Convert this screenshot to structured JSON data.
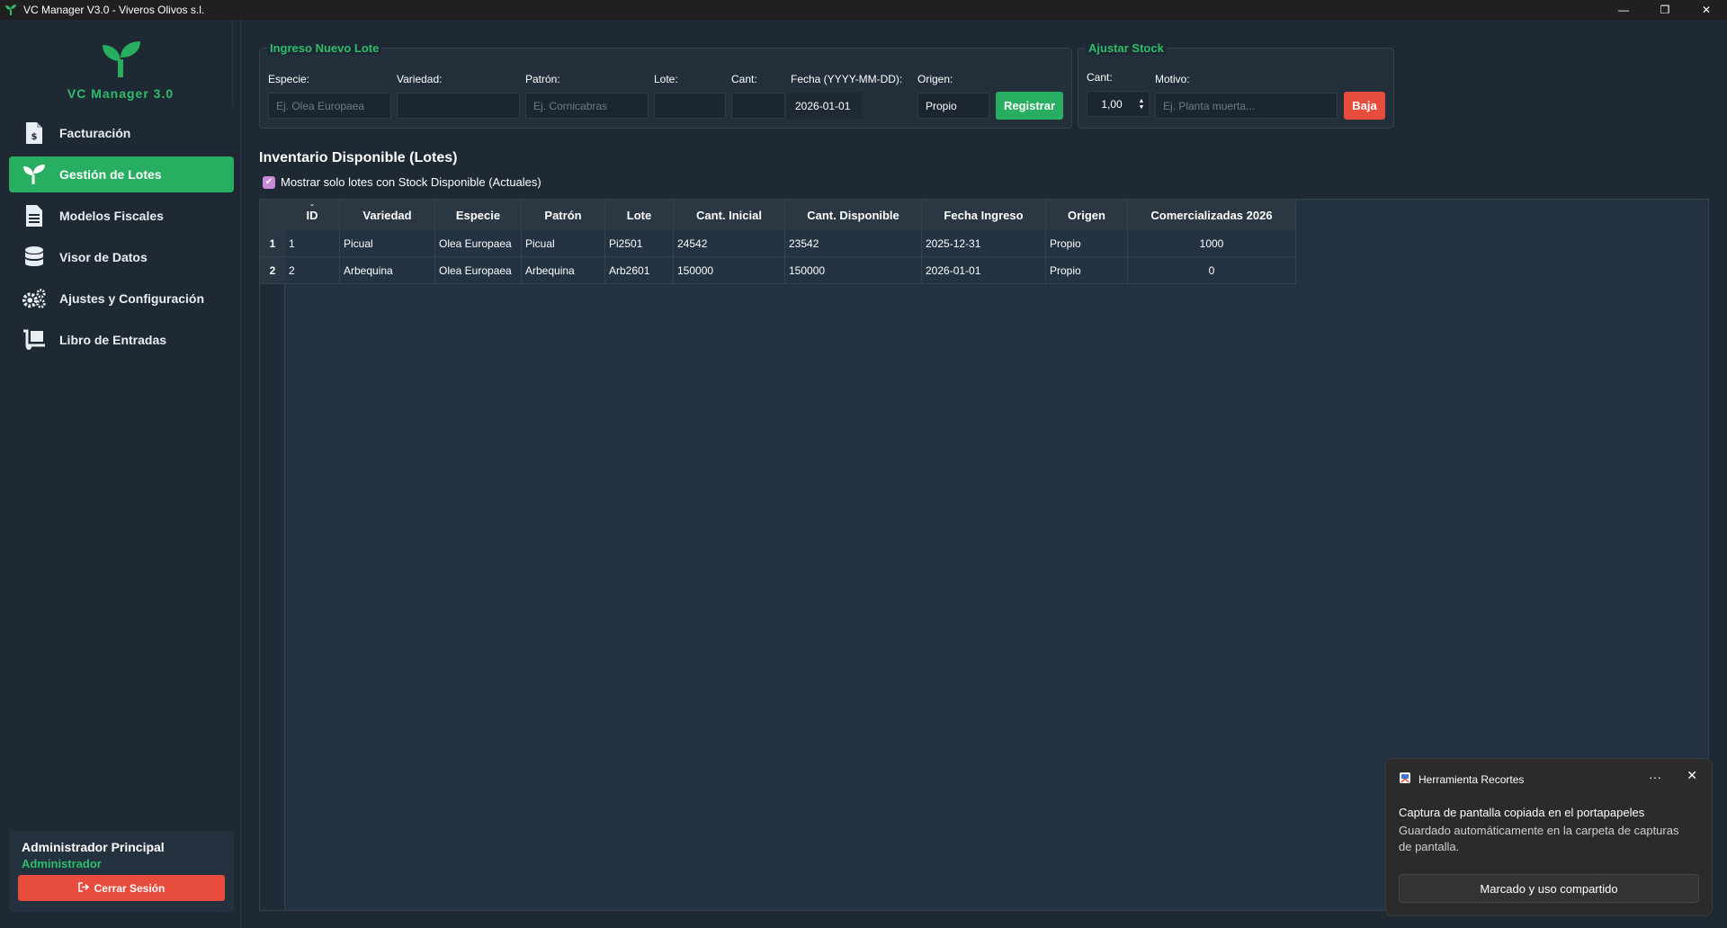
{
  "window": {
    "title": "VC Manager V3.0 - Viveros Olivos s.l.",
    "controls": {
      "minimize": "—",
      "restore": "❐",
      "close": "✕"
    }
  },
  "sidebar": {
    "logo_title": "VC Manager 3.0",
    "items": [
      {
        "label": "Facturación",
        "icon": "invoice-icon",
        "active": false
      },
      {
        "label": "Gestión de Lotes",
        "icon": "sprout-icon",
        "active": true
      },
      {
        "label": "Modelos Fiscales",
        "icon": "document-icon",
        "active": false
      },
      {
        "label": "Visor de Datos",
        "icon": "database-icon",
        "active": false
      },
      {
        "label": "Ajustes y Configuración",
        "icon": "gears-icon",
        "active": false
      },
      {
        "label": "Libro de Entradas",
        "icon": "dolly-icon",
        "active": false
      }
    ],
    "user": {
      "name": "Administrador Principal",
      "role": "Administrador",
      "logout_label": "Cerrar Sesión"
    }
  },
  "ingreso": {
    "title": "Ingreso Nuevo Lote",
    "especie_label": "Especie:",
    "especie_placeholder": "Ej. Olea Europaea",
    "variedad_label": "Variedad:",
    "variedad_value": "",
    "patron_label": "Patrón:",
    "patron_placeholder": "Ej. Cornicabras",
    "lote_label": "Lote:",
    "lote_value": "",
    "cant_label": "Cant:",
    "cant_value": "",
    "fecha_label": "Fecha (YYYY-MM-DD):",
    "fecha_value": "2026-01-01",
    "origen_label": "Origen:",
    "origen_value": "Propio",
    "registrar_label": "Registrar"
  },
  "ajustar": {
    "title": "Ajustar Stock",
    "cant_label": "Cant:",
    "cant_value": "1,00",
    "motivo_label": "Motivo:",
    "motivo_placeholder": "Ej. Planta muerta...",
    "baja_label": "Baja"
  },
  "inventario": {
    "title": "Inventario Disponible (Lotes)",
    "filter_label": "Mostrar solo lotes con Stock Disponible (Actuales)",
    "filter_checked": true,
    "columns": [
      "ID",
      "Variedad",
      "Especie",
      "Patrón",
      "Lote",
      "Cant. Inicial",
      "Cant. Disponible",
      "Fecha Ingreso",
      "Origen",
      "Comercializadas 2026"
    ],
    "row_numbers": [
      "1",
      "2"
    ],
    "rows": [
      [
        "1",
        "Picual",
        "Olea Europaea",
        "Picual",
        "Pi2501",
        "24542",
        "23542",
        "2025-12-31",
        "Propio",
        "1000"
      ],
      [
        "2",
        "Arbequina",
        "Olea Europaea",
        "Arbequina",
        "Arb2601",
        "150000",
        "150000",
        "2026-01-01",
        "Propio",
        "0"
      ]
    ]
  },
  "toast": {
    "app_name": "Herramienta Recortes",
    "more": "···",
    "close": "✕",
    "title": "Captura de pantalla copiada en el portapapeles",
    "body": "Guardado automáticamente en la carpeta de capturas de pantalla.",
    "button_label": "Marcado y uso compartido"
  },
  "colors": {
    "accent_green": "#27ae60",
    "danger_red": "#e74c3c",
    "background": "#1e2933",
    "checkbox": "#c98bd9"
  }
}
